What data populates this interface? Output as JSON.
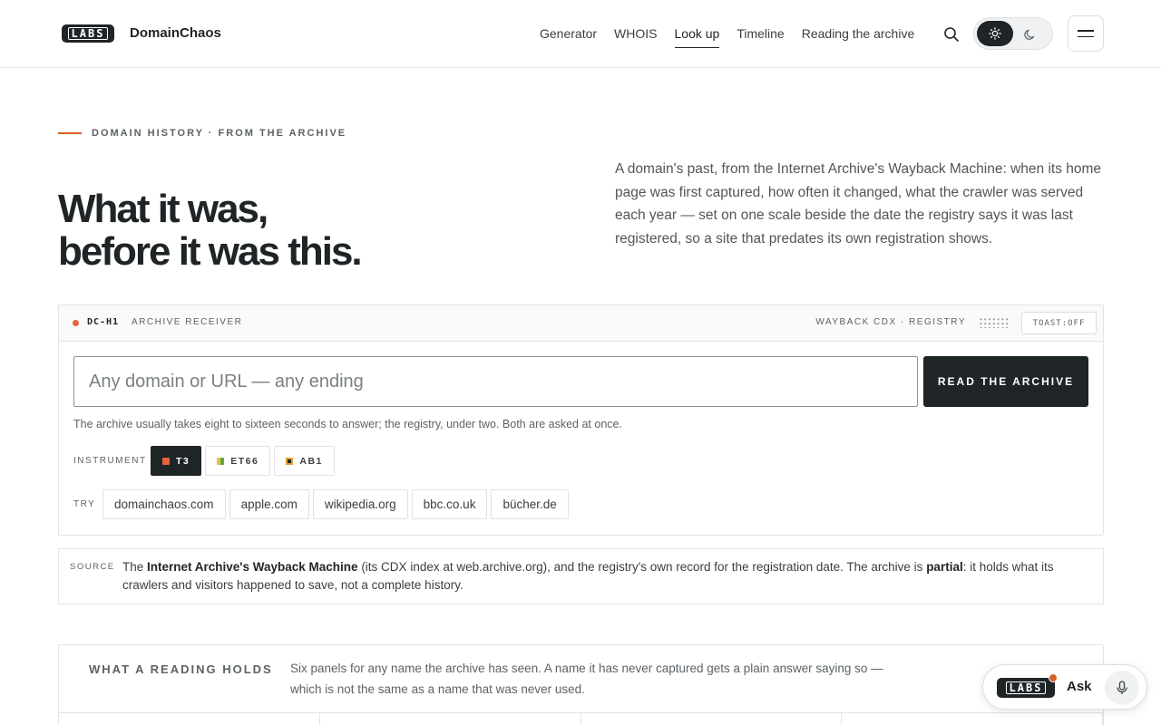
{
  "header": {
    "logo_text": "LABS",
    "brand": "DomainChaos",
    "nav": [
      {
        "label": "Generator",
        "active": false
      },
      {
        "label": "WHOIS",
        "active": false
      },
      {
        "label": "Look up",
        "active": true
      },
      {
        "label": "Timeline",
        "active": false
      },
      {
        "label": "Reading the archive",
        "active": false
      }
    ],
    "icons": {
      "search": "search-icon",
      "light": "sun-icon",
      "dark": "moon-icon",
      "menu": "menu-icon"
    },
    "theme": "light"
  },
  "hero": {
    "eyebrow": "DOMAIN HISTORY · FROM THE ARCHIVE",
    "title_line1": "What it was,",
    "title_line2": "before it was this.",
    "description": "A domain's past, from the Internet Archive's Wayback Machine: when its home page was first captured, how often it changed, what the crawler was served each year — set on one scale beside the date the registry says it was last registered, so a site that predates its own registration shows."
  },
  "receiver": {
    "id": "DC-H1",
    "label": "ARCHIVE RECEIVER",
    "sources": "WAYBACK CDX · REGISTRY",
    "toast": "TOAST:OFF",
    "input_placeholder": "Any domain or URL — any ending",
    "input_value": "",
    "submit_label": "READ THE ARCHIVE",
    "hint": "The archive usually takes eight to sixteen seconds to answer; the registry, under two. Both are asked at once.",
    "instrument_label": "INSTRUMENT",
    "instruments": [
      {
        "label": "T3",
        "selected": true
      },
      {
        "label": "ET66",
        "selected": false
      },
      {
        "label": "AB1",
        "selected": false
      }
    ],
    "try_label": "TRY",
    "examples": [
      "domainchaos.com",
      "apple.com",
      "wikipedia.org",
      "bbc.co.uk",
      "bücher.de"
    ]
  },
  "source": {
    "label": "SOURCE",
    "part1": "The ",
    "bold1": "Internet Archive's Wayback Machine",
    "part2": " (its CDX index at web.archive.org), and the registry's own record for the registration date. The archive is ",
    "bold2": "partial",
    "part3": ": it holds what its crawlers and visitors happened to save, not a complete history."
  },
  "holds": {
    "title": "WHAT A READING HOLDS",
    "text": "Six panels for any name the archive has seen. A name it has never captured gets a plain answer saying so — which is not the same as a name that was never used."
  },
  "ask": {
    "logo_text": "LABS",
    "label": "Ask",
    "icon": "microphone-icon"
  },
  "colors": {
    "ink": "#1f2426",
    "accent": "#e8643a",
    "border": "#e2e3e4",
    "muted": "#5c6266"
  }
}
